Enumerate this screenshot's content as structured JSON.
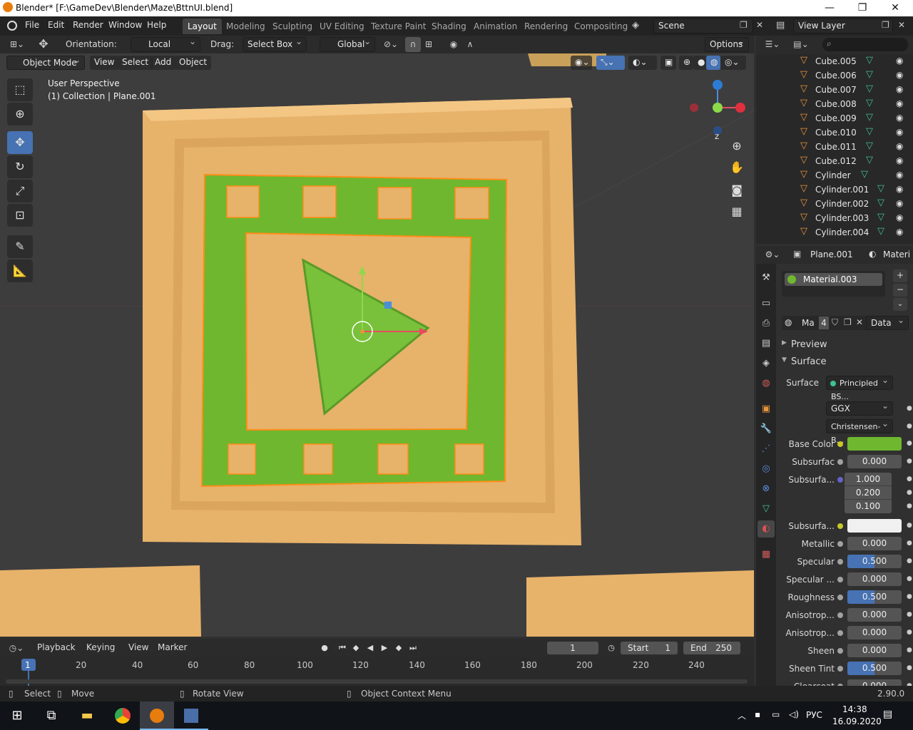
{
  "window": {
    "title": "Blender* [F:\\GameDev\\Blender\\Maze\\BttnUI.blend]",
    "minimize": "—",
    "maximize": "❐",
    "close": "✕"
  },
  "menu": [
    "File",
    "Edit",
    "Render",
    "Window",
    "Help"
  ],
  "workspaces": [
    "Layout",
    "Modeling",
    "Sculpting",
    "UV Editing",
    "Texture Paint",
    "Shading",
    "Animation",
    "Rendering",
    "Compositing"
  ],
  "active_workspace": "Layout",
  "scene": {
    "name": "Scene",
    "view_layer": "View Layer"
  },
  "tool_header": {
    "orientation_label": "Orientation:",
    "orientation_value": "Local",
    "drag_label": "Drag:",
    "drag_value": "Select Box",
    "transform_orientation": "Global",
    "options": "Options"
  },
  "viewport": {
    "mode": "Object Mode",
    "menus": [
      "View",
      "Select",
      "Add",
      "Object"
    ],
    "perspective": "User Perspective",
    "collection_info": "(1) Collection | Plane.001",
    "gizmo_axes": {
      "z": "Z",
      "x": "X"
    }
  },
  "timeline": {
    "menus": [
      "Playback",
      "Keying",
      "View",
      "Marker"
    ],
    "current_frame": "1",
    "start_label": "Start",
    "start": "1",
    "end_label": "End",
    "end": "250",
    "ticks": [
      "1",
      "20",
      "40",
      "60",
      "80",
      "100",
      "120",
      "140",
      "160",
      "180",
      "200",
      "220",
      "240"
    ]
  },
  "status_bar": {
    "select": "Select",
    "move": "Move",
    "rotate_view": "Rotate View",
    "context_menu": "Object Context Menu",
    "version": "2.90.0"
  },
  "outliner": {
    "items": [
      "Cube.005",
      "Cube.006",
      "Cube.007",
      "Cube.008",
      "Cube.009",
      "Cube.010",
      "Cube.011",
      "Cube.012",
      "Cylinder",
      "Cylinder.001",
      "Cylinder.002",
      "Cylinder.003",
      "Cylinder.004"
    ]
  },
  "properties": {
    "object": "Plane.001",
    "tab_label": "Materi",
    "material_slot": "Material.003",
    "material_short": "Ma",
    "users": "4",
    "link": "Data",
    "preview": "Preview",
    "surface_panel": "Surface",
    "surface_label": "Surface",
    "surface_shader": "Principled BS...",
    "distribution": "GGX",
    "subsurface_method": "Christensen-B...",
    "rows": [
      {
        "label": "Base Color",
        "type": "color",
        "color": "#6fb72e",
        "socket": "#c7c729"
      },
      {
        "label": "Subsurfac",
        "value": "0.000",
        "socket": "#a1a1a1"
      },
      {
        "label": "Subsurfa...",
        "vector": [
          "1.000",
          "0.200",
          "0.100"
        ],
        "socket": "#6363c7"
      },
      {
        "label": "Subsurfa...",
        "type": "color",
        "color": "#f0f0f0",
        "socket": "#c7c729"
      },
      {
        "label": "Metallic",
        "value": "0.000",
        "socket": "#a1a1a1"
      },
      {
        "label": "Specular",
        "value": "0.500",
        "fill": 0.5,
        "socket": "#a1a1a1"
      },
      {
        "label": "Specular ...",
        "value": "0.000",
        "socket": "#a1a1a1"
      },
      {
        "label": "Roughness",
        "value": "0.500",
        "fill": 0.5,
        "socket": "#a1a1a1"
      },
      {
        "label": "Anisotrop...",
        "value": "0.000",
        "socket": "#a1a1a1"
      },
      {
        "label": "Anisotrop...",
        "value": "0.000",
        "socket": "#a1a1a1"
      },
      {
        "label": "Sheen",
        "value": "0.000",
        "socket": "#a1a1a1"
      },
      {
        "label": "Sheen Tint",
        "value": "0.500",
        "fill": 0.5,
        "socket": "#a1a1a1"
      },
      {
        "label": "Clearcoat",
        "value": "0.000",
        "socket": "#a1a1a1"
      }
    ]
  },
  "taskbar": {
    "lang": "РУС",
    "time": "14:38",
    "date": "16.09.2020"
  },
  "colors": {
    "accent": "#4772b3",
    "mesh_orange": "#e7b26a",
    "mesh_green": "#6fb72e",
    "selection": "#ff8c19"
  }
}
